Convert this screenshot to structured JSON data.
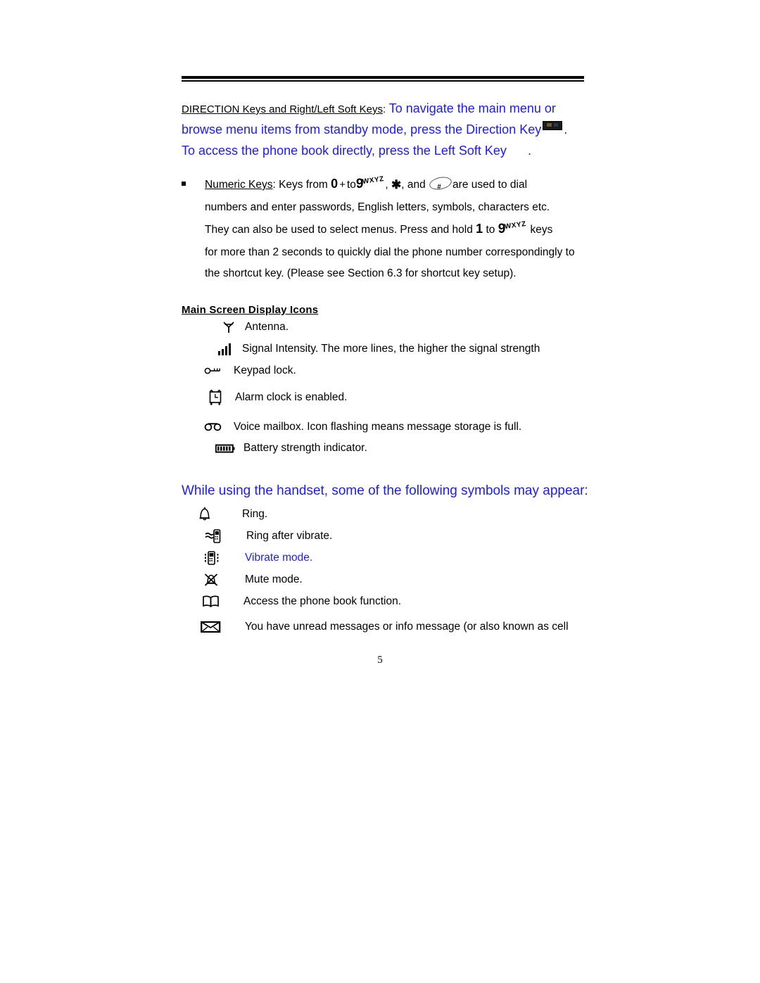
{
  "document": {
    "page_number": "5"
  },
  "intro": {
    "lead_underlined": "DIRECTION Keys and Right/Left Soft Keys",
    "lead_colon": ":",
    "blue_line1": "To navigate the main menu or",
    "blue_line2_pre": "browse menu items from standby mode, press the Direction Key",
    "blue_line2_post": ".",
    "blue_line3_pre": "To access the phone book directly, press the Left Soft Key",
    "blue_line3_post": ".",
    "direction_key_icon": "direction-key-icon",
    "left_soft_key_icon": "left-soft-key-icon"
  },
  "numeric_keys": {
    "bullet": "square-bullet",
    "label_underlined": "Numeric Keys",
    "text_1": ": Keys from",
    "key_zero": "0",
    "key_plus": "+",
    "text_to": "to",
    "key_nine": "9",
    "key_nine_sup": "WXYZ",
    "text_2": ",",
    "key_star": "✱",
    "text_3": ", and",
    "key_hash": "#",
    "text_4": "are used to dial",
    "line_2": "numbers and enter passwords, English letters, symbols, characters etc.",
    "line_3_pre": "They can also be used to select menus. Press and hold",
    "key_one": "1",
    "line_3_mid": "to",
    "line_3_post": "keys",
    "line_4": "for more than 2 seconds to quickly dial the phone number correspondingly to",
    "line_5": "the shortcut key. (Please see Section 6.3 for shortcut key setup)."
  },
  "main_screen_section": {
    "heading": "Main Screen Display Icons",
    "items": [
      {
        "icon": "antenna-icon",
        "label": "Antenna."
      },
      {
        "icon": "signal-bars-icon",
        "label": "Signal Intensity. The more lines, the higher the signal strength"
      },
      {
        "icon": "keypad-lock-key-icon",
        "label": "Keypad lock."
      },
      {
        "icon": "alarm-clock-icon",
        "label": "Alarm clock is enabled."
      },
      {
        "icon": "voice-mailbox-icon",
        "label": "Voice mailbox. Icon flashing means message storage is full."
      },
      {
        "icon": "battery-icon",
        "label": "Battery strength indicator."
      }
    ]
  },
  "handset_symbols_section": {
    "heading": "While using the handset, some of the following symbols may appear:",
    "items": [
      {
        "icon": "bell-ring-icon",
        "label": "Ring.",
        "color": "#000000"
      },
      {
        "icon": "ring-after-vibrate-icon",
        "label": "Ring after vibrate.",
        "color": "#000000"
      },
      {
        "icon": "vibrate-mode-icon",
        "label": "Vibrate mode.",
        "color": "#1a1aff"
      },
      {
        "icon": "mute-mode-icon",
        "label": "Mute mode.",
        "color": "#000000"
      },
      {
        "icon": "phone-book-icon",
        "label": "Access the phone book function.",
        "color": "#000000"
      },
      {
        "icon": "envelope-icon",
        "label": "You have unread messages or info message (or also known as cell",
        "color": "#000000"
      }
    ]
  },
  "colors": {
    "blue": "#1a1aff",
    "black": "#000000",
    "page_background": "#ffffff"
  }
}
